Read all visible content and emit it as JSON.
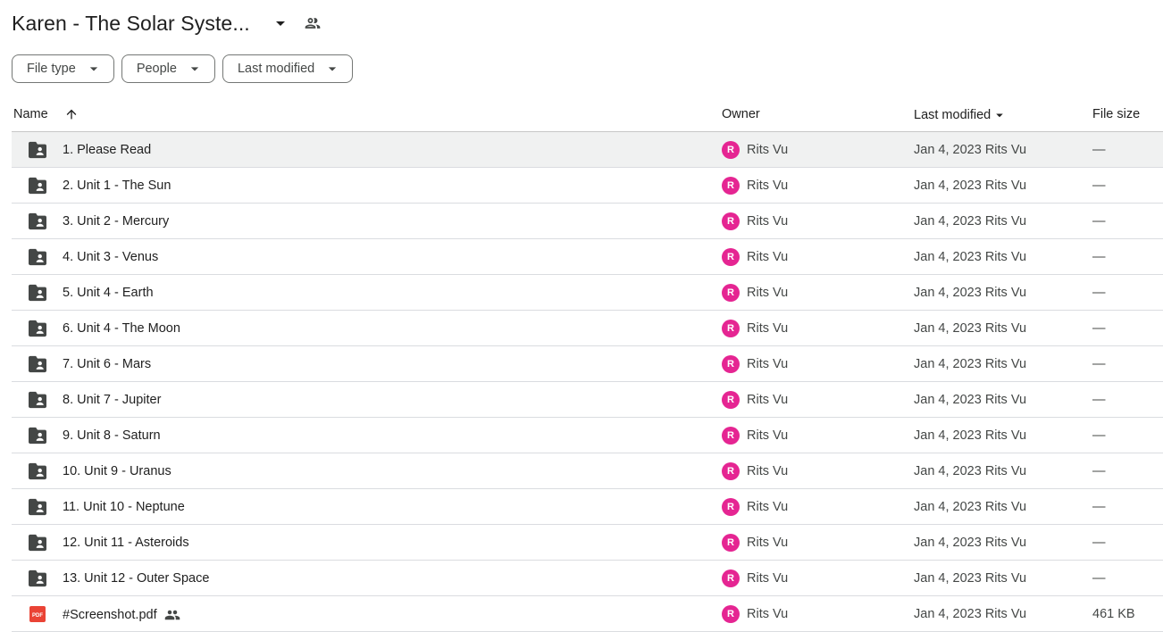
{
  "header": {
    "title": "Karen - The Solar Syste...",
    "caret_icon": "arrow-drop-down-icon",
    "shared_icon": "people-icon"
  },
  "filters": [
    {
      "label": "File type"
    },
    {
      "label": "People"
    },
    {
      "label": "Last modified"
    }
  ],
  "columns": {
    "name": "Name",
    "owner": "Owner",
    "last_modified": "Last modified",
    "file_size": "File size"
  },
  "colors": {
    "avatar": "#e52592",
    "folder_icon": "#444746",
    "pdf_icon": "#ea4335",
    "selected_row": "#f0f1f1"
  },
  "rows": [
    {
      "name": "1. Please Read",
      "type": "shared-folder",
      "owner_initial": "R",
      "owner": "Rits Vu",
      "modified": "Jan 4, 2023 Rits Vu",
      "size": "—",
      "shared": false
    },
    {
      "name": "2. Unit 1 - The Sun",
      "type": "shared-folder",
      "owner_initial": "R",
      "owner": "Rits Vu",
      "modified": "Jan 4, 2023 Rits Vu",
      "size": "—",
      "shared": false
    },
    {
      "name": "3. Unit 2 - Mercury",
      "type": "shared-folder",
      "owner_initial": "R",
      "owner": "Rits Vu",
      "modified": "Jan 4, 2023 Rits Vu",
      "size": "—",
      "shared": false
    },
    {
      "name": "4. Unit 3 - Venus",
      "type": "shared-folder",
      "owner_initial": "R",
      "owner": "Rits Vu",
      "modified": "Jan 4, 2023 Rits Vu",
      "size": "—",
      "shared": false
    },
    {
      "name": "5. Unit 4 - Earth",
      "type": "shared-folder",
      "owner_initial": "R",
      "owner": "Rits Vu",
      "modified": "Jan 4, 2023 Rits Vu",
      "size": "—",
      "shared": false
    },
    {
      "name": "6. Unit 4 - The Moon",
      "type": "shared-folder",
      "owner_initial": "R",
      "owner": "Rits Vu",
      "modified": "Jan 4, 2023 Rits Vu",
      "size": "—",
      "shared": false
    },
    {
      "name": "7. Unit 6 - Mars",
      "type": "shared-folder",
      "owner_initial": "R",
      "owner": "Rits Vu",
      "modified": "Jan 4, 2023 Rits Vu",
      "size": "—",
      "shared": false
    },
    {
      "name": "8. Unit 7 - Jupiter",
      "type": "shared-folder",
      "owner_initial": "R",
      "owner": "Rits Vu",
      "modified": "Jan 4, 2023 Rits Vu",
      "size": "—",
      "shared": false
    },
    {
      "name": "9. Unit 8 - Saturn",
      "type": "shared-folder",
      "owner_initial": "R",
      "owner": "Rits Vu",
      "modified": "Jan 4, 2023 Rits Vu",
      "size": "—",
      "shared": false
    },
    {
      "name": "10. Unit 9 - Uranus",
      "type": "shared-folder",
      "owner_initial": "R",
      "owner": "Rits Vu",
      "modified": "Jan 4, 2023 Rits Vu",
      "size": "—",
      "shared": false
    },
    {
      "name": "11. Unit 10 - Neptune",
      "type": "shared-folder",
      "owner_initial": "R",
      "owner": "Rits Vu",
      "modified": "Jan 4, 2023 Rits Vu",
      "size": "—",
      "shared": false
    },
    {
      "name": "12. Unit 11 - Asteroids",
      "type": "shared-folder",
      "owner_initial": "R",
      "owner": "Rits Vu",
      "modified": "Jan 4, 2023 Rits Vu",
      "size": "—",
      "shared": false
    },
    {
      "name": "13. Unit 12 - Outer Space",
      "type": "shared-folder",
      "owner_initial": "R",
      "owner": "Rits Vu",
      "modified": "Jan 4, 2023 Rits Vu",
      "size": "—",
      "shared": false
    },
    {
      "name": "#Screenshot.pdf",
      "type": "pdf",
      "owner_initial": "R",
      "owner": "Rits Vu",
      "modified": "Jan 4, 2023 Rits Vu",
      "size": "461 KB",
      "shared": true
    }
  ]
}
